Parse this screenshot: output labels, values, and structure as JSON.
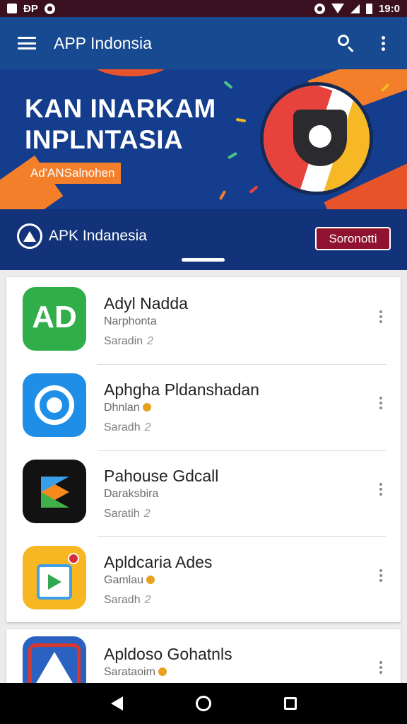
{
  "statusbar": {
    "left_text": "ĐP",
    "time": "19:0"
  },
  "appbar": {
    "title": "APP Indonsia"
  },
  "banner": {
    "title_line1": "KAN INARKAM",
    "title_line2": "INPLNTASIA",
    "tag": "Ad'ANSalnohen"
  },
  "brand": {
    "name": "APK Indanesia",
    "button": "Soronotti"
  },
  "apps": [
    {
      "name": "Adyl  Nadda",
      "subtitle": "Narphonta",
      "developer": "Saradin",
      "num": "2",
      "icon": "green-app-icon",
      "badge": false
    },
    {
      "name": "Aphgha Pldanshadan",
      "subtitle": "Dhnlan",
      "developer": "Saradh",
      "num": "2",
      "icon": "blue-app-icon",
      "badge": true
    },
    {
      "name": "Pahouse Gdcall",
      "subtitle": "Daraksbira",
      "developer": "Saratih",
      "num": "2",
      "icon": "play-app-icon",
      "badge": false
    },
    {
      "name": "Apldcaria Ades",
      "subtitle": "Gamlau",
      "developer": "Saradh",
      "num": "2",
      "icon": "store-app-icon",
      "badge": true
    },
    {
      "name": "Apldoso Gohatnls",
      "subtitle": "Sarataoim",
      "developer": "",
      "num": "",
      "icon": "delta-app-icon",
      "badge": true
    }
  ],
  "colors": {
    "appbar": "#184a92",
    "banner": "#143d8e",
    "accent": "#f37f2a",
    "button": "#8f1331",
    "status": "#3a0f1f"
  }
}
